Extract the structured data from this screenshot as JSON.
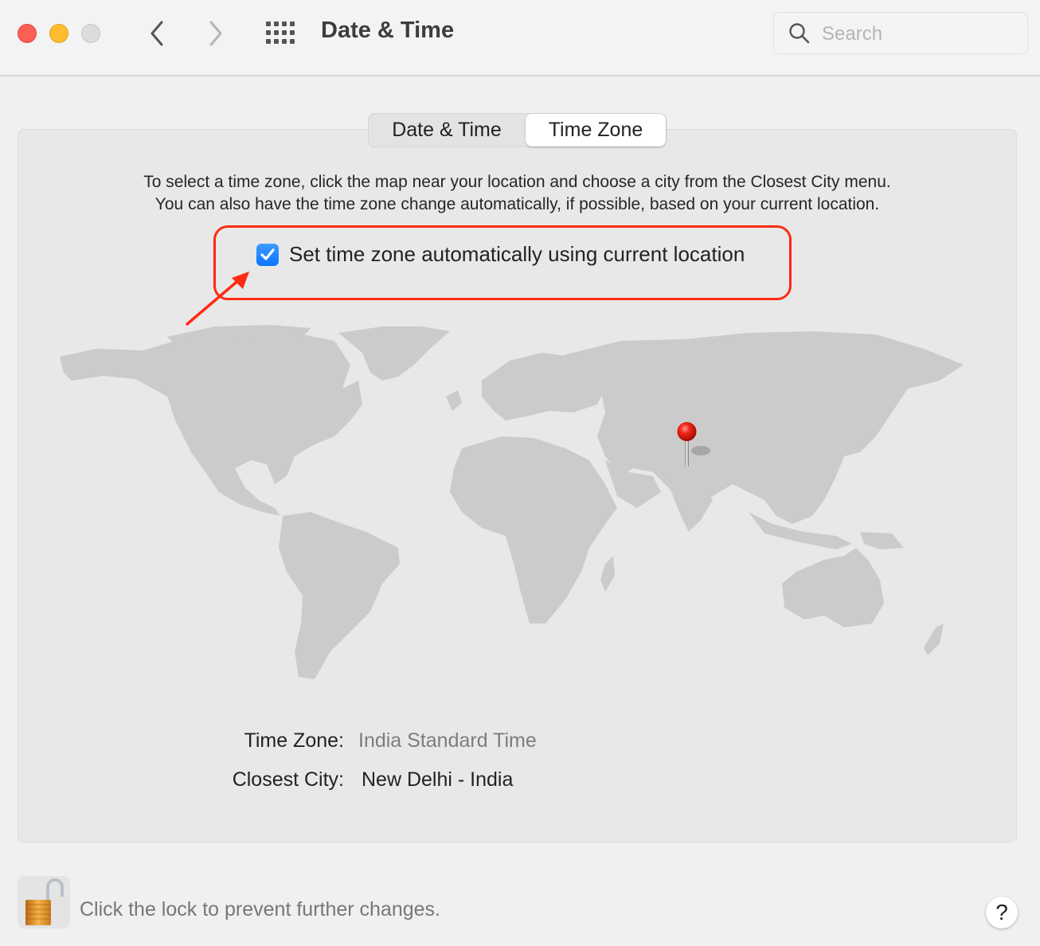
{
  "window": {
    "title": "Date & Time",
    "traffic_lights": [
      "close",
      "minimize",
      "zoom-disabled"
    ],
    "nav": {
      "back_icon": "chevron-left-icon",
      "forward_icon": "chevron-right-icon",
      "grid_icon": "show-all-grid-icon"
    }
  },
  "search": {
    "placeholder": "Search",
    "value": ""
  },
  "tabs": [
    {
      "label": "Date & Time",
      "selected": false
    },
    {
      "label": "Time Zone",
      "selected": true
    }
  ],
  "description": {
    "line1": "To select a time zone, click the map near your location and choose a city from the Closest City menu.",
    "line2": "You can also have the time zone change automatically, if possible, based on your current location."
  },
  "auto_timezone": {
    "label": "Set time zone automatically using current location",
    "checked": true
  },
  "annotation": {
    "color": "#ff2a12",
    "highlight": "auto-timezone-checkbox"
  },
  "map": {
    "pin_location": "New Delhi, India",
    "pin_color": "#e8150f"
  },
  "info": {
    "time_zone_label": "Time Zone:",
    "time_zone_value": "India Standard Time",
    "closest_city_label": "Closest City:",
    "closest_city_value": "New Delhi - India"
  },
  "footer": {
    "lock_state": "unlocked",
    "lock_text": "Click the lock to prevent further changes.",
    "help_label": "?"
  },
  "colors": {
    "accent": "#0a74ff",
    "panel": "#e8e8e8",
    "land": "#cbcbcb"
  }
}
